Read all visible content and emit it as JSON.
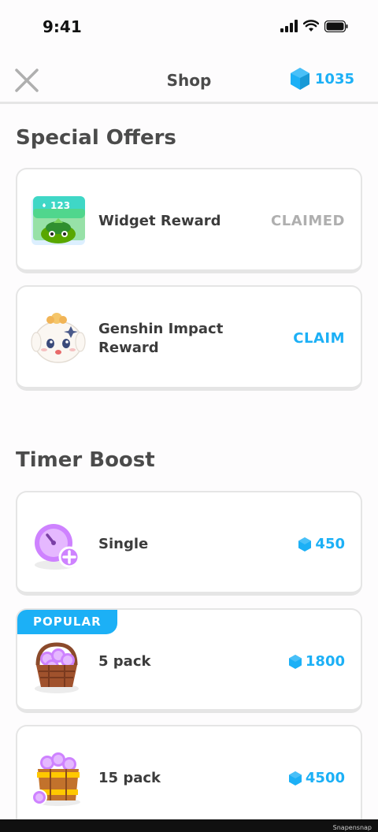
{
  "status": {
    "time": "9:41"
  },
  "header": {
    "title": "Shop",
    "gems": "1035"
  },
  "special_offers": {
    "title": "Special Offers",
    "items": [
      {
        "label": "Widget Reward",
        "action": "CLAIMED",
        "badge_number": "123"
      },
      {
        "label_line1": "Genshin Impact",
        "label_line2": "Reward",
        "action": "CLAIM"
      }
    ]
  },
  "timer_boost": {
    "title": "Timer Boost",
    "items": [
      {
        "label": "Single",
        "price": "450"
      },
      {
        "label": "5 pack",
        "price": "1800",
        "badge": "POPULAR"
      },
      {
        "label": "15 pack",
        "price": "4500"
      }
    ]
  },
  "watermark": "Snapensnap",
  "colors": {
    "accent": "#1cb0f6",
    "claimed": "#afafaf",
    "text": "#3c3c3c",
    "border": "#e5e5e5"
  }
}
